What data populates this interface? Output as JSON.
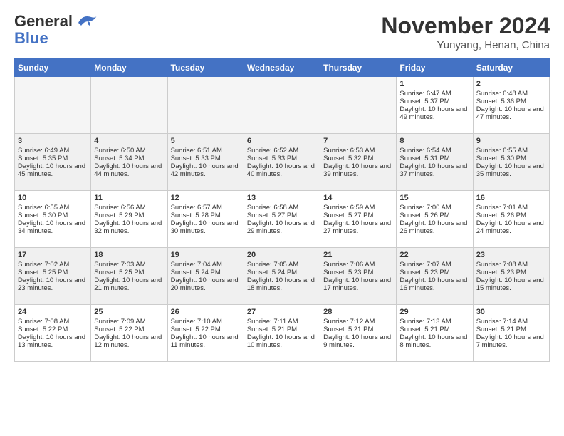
{
  "header": {
    "logo_general": "General",
    "logo_blue": "Blue",
    "month_title": "November 2024",
    "location": "Yunyang, Henan, China"
  },
  "days_of_week": [
    "Sunday",
    "Monday",
    "Tuesday",
    "Wednesday",
    "Thursday",
    "Friday",
    "Saturday"
  ],
  "weeks": [
    {
      "row_class": "week-row-1",
      "days": [
        {
          "num": "",
          "empty": true
        },
        {
          "num": "",
          "empty": true
        },
        {
          "num": "",
          "empty": true
        },
        {
          "num": "",
          "empty": true
        },
        {
          "num": "",
          "empty": true
        },
        {
          "num": "1",
          "sunrise": "Sunrise: 6:47 AM",
          "sunset": "Sunset: 5:37 PM",
          "daylight": "Daylight: 10 hours and 49 minutes."
        },
        {
          "num": "2",
          "sunrise": "Sunrise: 6:48 AM",
          "sunset": "Sunset: 5:36 PM",
          "daylight": "Daylight: 10 hours and 47 minutes."
        }
      ]
    },
    {
      "row_class": "week-row-2",
      "days": [
        {
          "num": "3",
          "sunrise": "Sunrise: 6:49 AM",
          "sunset": "Sunset: 5:35 PM",
          "daylight": "Daylight: 10 hours and 45 minutes."
        },
        {
          "num": "4",
          "sunrise": "Sunrise: 6:50 AM",
          "sunset": "Sunset: 5:34 PM",
          "daylight": "Daylight: 10 hours and 44 minutes."
        },
        {
          "num": "5",
          "sunrise": "Sunrise: 6:51 AM",
          "sunset": "Sunset: 5:33 PM",
          "daylight": "Daylight: 10 hours and 42 minutes."
        },
        {
          "num": "6",
          "sunrise": "Sunrise: 6:52 AM",
          "sunset": "Sunset: 5:33 PM",
          "daylight": "Daylight: 10 hours and 40 minutes."
        },
        {
          "num": "7",
          "sunrise": "Sunrise: 6:53 AM",
          "sunset": "Sunset: 5:32 PM",
          "daylight": "Daylight: 10 hours and 39 minutes."
        },
        {
          "num": "8",
          "sunrise": "Sunrise: 6:54 AM",
          "sunset": "Sunset: 5:31 PM",
          "daylight": "Daylight: 10 hours and 37 minutes."
        },
        {
          "num": "9",
          "sunrise": "Sunrise: 6:55 AM",
          "sunset": "Sunset: 5:30 PM",
          "daylight": "Daylight: 10 hours and 35 minutes."
        }
      ]
    },
    {
      "row_class": "week-row-3",
      "days": [
        {
          "num": "10",
          "sunrise": "Sunrise: 6:55 AM",
          "sunset": "Sunset: 5:30 PM",
          "daylight": "Daylight: 10 hours and 34 minutes."
        },
        {
          "num": "11",
          "sunrise": "Sunrise: 6:56 AM",
          "sunset": "Sunset: 5:29 PM",
          "daylight": "Daylight: 10 hours and 32 minutes."
        },
        {
          "num": "12",
          "sunrise": "Sunrise: 6:57 AM",
          "sunset": "Sunset: 5:28 PM",
          "daylight": "Daylight: 10 hours and 30 minutes."
        },
        {
          "num": "13",
          "sunrise": "Sunrise: 6:58 AM",
          "sunset": "Sunset: 5:27 PM",
          "daylight": "Daylight: 10 hours and 29 minutes."
        },
        {
          "num": "14",
          "sunrise": "Sunrise: 6:59 AM",
          "sunset": "Sunset: 5:27 PM",
          "daylight": "Daylight: 10 hours and 27 minutes."
        },
        {
          "num": "15",
          "sunrise": "Sunrise: 7:00 AM",
          "sunset": "Sunset: 5:26 PM",
          "daylight": "Daylight: 10 hours and 26 minutes."
        },
        {
          "num": "16",
          "sunrise": "Sunrise: 7:01 AM",
          "sunset": "Sunset: 5:26 PM",
          "daylight": "Daylight: 10 hours and 24 minutes."
        }
      ]
    },
    {
      "row_class": "week-row-4",
      "days": [
        {
          "num": "17",
          "sunrise": "Sunrise: 7:02 AM",
          "sunset": "Sunset: 5:25 PM",
          "daylight": "Daylight: 10 hours and 23 minutes."
        },
        {
          "num": "18",
          "sunrise": "Sunrise: 7:03 AM",
          "sunset": "Sunset: 5:25 PM",
          "daylight": "Daylight: 10 hours and 21 minutes."
        },
        {
          "num": "19",
          "sunrise": "Sunrise: 7:04 AM",
          "sunset": "Sunset: 5:24 PM",
          "daylight": "Daylight: 10 hours and 20 minutes."
        },
        {
          "num": "20",
          "sunrise": "Sunrise: 7:05 AM",
          "sunset": "Sunset: 5:24 PM",
          "daylight": "Daylight: 10 hours and 18 minutes."
        },
        {
          "num": "21",
          "sunrise": "Sunrise: 7:06 AM",
          "sunset": "Sunset: 5:23 PM",
          "daylight": "Daylight: 10 hours and 17 minutes."
        },
        {
          "num": "22",
          "sunrise": "Sunrise: 7:07 AM",
          "sunset": "Sunset: 5:23 PM",
          "daylight": "Daylight: 10 hours and 16 minutes."
        },
        {
          "num": "23",
          "sunrise": "Sunrise: 7:08 AM",
          "sunset": "Sunset: 5:23 PM",
          "daylight": "Daylight: 10 hours and 15 minutes."
        }
      ]
    },
    {
      "row_class": "week-row-5",
      "days": [
        {
          "num": "24",
          "sunrise": "Sunrise: 7:08 AM",
          "sunset": "Sunset: 5:22 PM",
          "daylight": "Daylight: 10 hours and 13 minutes."
        },
        {
          "num": "25",
          "sunrise": "Sunrise: 7:09 AM",
          "sunset": "Sunset: 5:22 PM",
          "daylight": "Daylight: 10 hours and 12 minutes."
        },
        {
          "num": "26",
          "sunrise": "Sunrise: 7:10 AM",
          "sunset": "Sunset: 5:22 PM",
          "daylight": "Daylight: 10 hours and 11 minutes."
        },
        {
          "num": "27",
          "sunrise": "Sunrise: 7:11 AM",
          "sunset": "Sunset: 5:21 PM",
          "daylight": "Daylight: 10 hours and 10 minutes."
        },
        {
          "num": "28",
          "sunrise": "Sunrise: 7:12 AM",
          "sunset": "Sunset: 5:21 PM",
          "daylight": "Daylight: 10 hours and 9 minutes."
        },
        {
          "num": "29",
          "sunrise": "Sunrise: 7:13 AM",
          "sunset": "Sunset: 5:21 PM",
          "daylight": "Daylight: 10 hours and 8 minutes."
        },
        {
          "num": "30",
          "sunrise": "Sunrise: 7:14 AM",
          "sunset": "Sunset: 5:21 PM",
          "daylight": "Daylight: 10 hours and 7 minutes."
        }
      ]
    }
  ]
}
